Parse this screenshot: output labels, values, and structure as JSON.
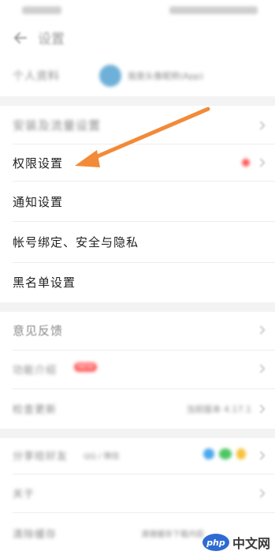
{
  "status_bar": {},
  "topbar": {
    "title": "设置",
    "back_icon": "back-arrow-icon"
  },
  "profile_row": {
    "label": "个人资料",
    "value": "我是头像昵称(App)"
  },
  "rows": {
    "install": "安装及流量设置",
    "permissions": "权限设置",
    "notifications": "通知设置",
    "account": "帐号绑定、安全与隐私",
    "blacklist": "黑名单设置",
    "feedback": "意见反馈",
    "intro": "功能介绍",
    "update": "检查更新",
    "share": "分享给好友",
    "about": "关于",
    "clear": "清除缓存"
  },
  "values": {
    "update": "当前版本 4.17.1",
    "share": "QQ / 微信",
    "clear": "清理缓存下载内容"
  },
  "badges": {
    "new_label": "NEW"
  },
  "colors": {
    "arrow": "#f28a38",
    "badge_red": "#ff5a5a",
    "divider": "#ededed",
    "section_gap": "#f3f3f3",
    "share_blue": "#4aa8f0",
    "share_green": "#4cc764",
    "share_yellow": "#f7c23a"
  },
  "watermark": {
    "logo": "php",
    "text": "中文网"
  }
}
